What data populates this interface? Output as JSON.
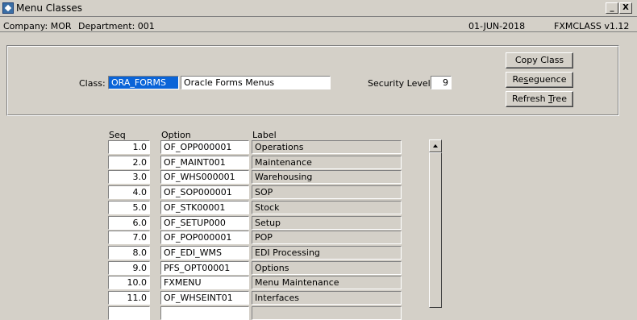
{
  "window": {
    "title": "Menu Classes",
    "minimize_label": "_",
    "close_label": "X"
  },
  "header": {
    "company": "Company:  MOR",
    "department": "Department:  001",
    "date": "01-JUN-2018",
    "form": "FXMCLASS  v1.12"
  },
  "form": {
    "class_label": "Class:",
    "class_code": "ORA_FORMS",
    "class_desc": "Oracle Forms Menus",
    "security_label": "Security Level:",
    "security_value": "9"
  },
  "buttons": {
    "copy_class": "Copy Class",
    "resequence_pre": "Re",
    "resequence_u": "s",
    "resequence_post": "eguence",
    "refresh_pre": "Refresh ",
    "refresh_u": "T",
    "refresh_post": "ree"
  },
  "table": {
    "headers": {
      "seq": "Seq",
      "option": "Option",
      "label": "Label"
    },
    "rows": [
      {
        "seq": "1.0",
        "option": "OF_OPP000001",
        "label": "Operations"
      },
      {
        "seq": "2.0",
        "option": "OF_MAINT001",
        "label": "Maintenance"
      },
      {
        "seq": "3.0",
        "option": "OF_WHS000001",
        "label": "Warehousing"
      },
      {
        "seq": "4.0",
        "option": "OF_SOP000001",
        "label": "SOP"
      },
      {
        "seq": "5.0",
        "option": "OF_STK00001",
        "label": "Stock"
      },
      {
        "seq": "6.0",
        "option": "OF_SETUP000",
        "label": "Setup"
      },
      {
        "seq": "7.0",
        "option": "OF_POP000001",
        "label": "POP"
      },
      {
        "seq": "8.0",
        "option": "OF_EDI_WMS",
        "label": "EDI Processing"
      },
      {
        "seq": "9.0",
        "option": "PFS_OPT00001",
        "label": "Options"
      },
      {
        "seq": "10.0",
        "option": "FXMENU",
        "label": "Menu Maintenance"
      },
      {
        "seq": "11.0",
        "option": "OF_WHSEINT01",
        "label": "Interfaces"
      },
      {
        "seq": "",
        "option": "",
        "label": ""
      }
    ]
  }
}
